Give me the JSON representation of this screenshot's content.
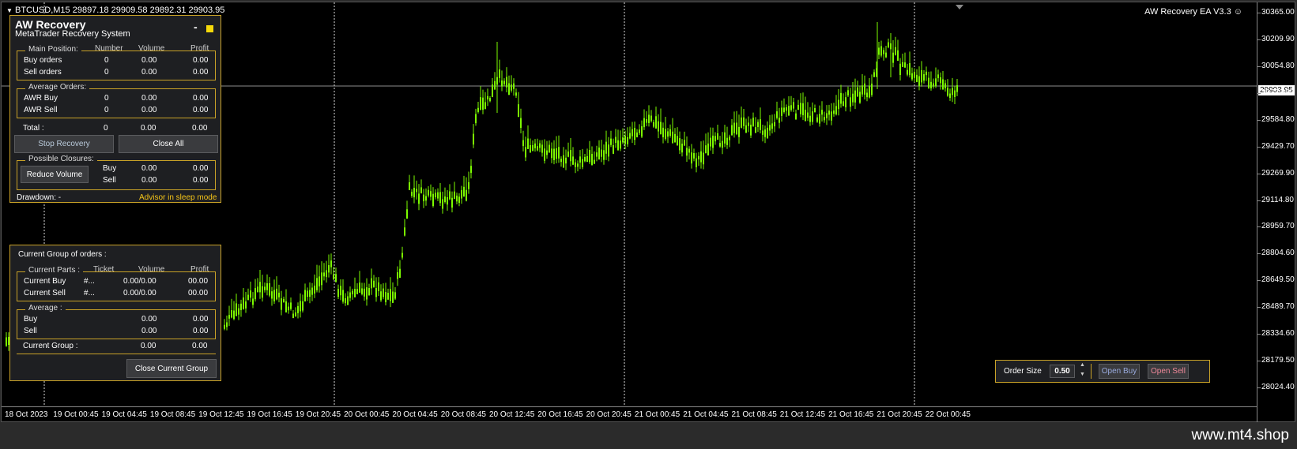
{
  "symbol_info": "BTCUSD,M15  29897.18 29909.58 29892.31 29903.95",
  "ea_label": "AW Recovery EA  V3.3",
  "price_labels": [
    "30365.00",
    "30209.90",
    "30054.80",
    "29739.90",
    "29584.80",
    "29429.70",
    "29269.90",
    "29114.80",
    "28959.70",
    "28804.60",
    "28649.50",
    "28489.70",
    "28334.60",
    "28179.50",
    "28024.40"
  ],
  "current_price": "29903.95",
  "time_labels": [
    "18 Oct 2023",
    "19 Oct 00:45",
    "19 Oct 04:45",
    "19 Oct 08:45",
    "19 Oct 12:45",
    "19 Oct 16:45",
    "19 Oct 20:45",
    "20 Oct 00:45",
    "20 Oct 04:45",
    "20 Oct 08:45",
    "20 Oct 12:45",
    "20 Oct 16:45",
    "20 Oct 20:45",
    "21 Oct 00:45",
    "21 Oct 04:45",
    "21 Oct 08:45",
    "21 Oct 12:45",
    "21 Oct 16:45",
    "21 Oct 20:45",
    "22 Oct 00:45"
  ],
  "colors": {
    "accent": "#c9a227",
    "candle": "#7CFC00",
    "status": "#f5c518"
  },
  "recovery_panel": {
    "title": "AW Recovery",
    "subtitle": "MetaTrader Recovery System",
    "minimize": "-",
    "main_position": {
      "legend": "Main Position:",
      "headers": [
        "Number",
        "Volume",
        "Profit"
      ],
      "rows": [
        {
          "label": "Buy orders",
          "number": "0",
          "volume": "0.00",
          "profit": "0.00"
        },
        {
          "label": "Sell orders",
          "number": "0",
          "volume": "0.00",
          "profit": "0.00"
        }
      ]
    },
    "average_orders": {
      "legend": "Average Orders:",
      "rows": [
        {
          "label": "AWR Buy",
          "number": "0",
          "volume": "0.00",
          "profit": "0.00"
        },
        {
          "label": "AWR Sell",
          "number": "0",
          "volume": "0.00",
          "profit": "0.00"
        }
      ]
    },
    "total": {
      "label": "Total :",
      "number": "0",
      "volume": "0.00",
      "profit": "0.00"
    },
    "stop_recovery": "Stop Recovery",
    "close_all": "Close All",
    "possible_closures": {
      "legend": "Possible Closures:",
      "reduce_volume": "Reduce Volume",
      "rows": [
        {
          "label": "Buy",
          "volume": "0.00",
          "profit": "0.00"
        },
        {
          "label": "Sell",
          "volume": "0.00",
          "profit": "0.00"
        }
      ]
    },
    "drawdown": "Drawdown: -",
    "status": "Advisor in sleep mode"
  },
  "group_panel": {
    "title": "Current Group of orders :",
    "current_parts": {
      "legend": "Current Parts :",
      "headers": [
        "Ticket",
        "Volume",
        "Profit"
      ],
      "rows": [
        {
          "label": "Current Buy",
          "ticket": "#...",
          "volume": "0.00/0.00",
          "profit": "00.00"
        },
        {
          "label": "Current Sell",
          "ticket": "#...",
          "volume": "0.00/0.00",
          "profit": "00.00"
        }
      ]
    },
    "average": {
      "legend": "Average :",
      "rows": [
        {
          "label": "Buy",
          "volume": "0.00",
          "profit": "0.00"
        },
        {
          "label": "Sell",
          "volume": "0.00",
          "profit": "0.00"
        }
      ]
    },
    "current_group": {
      "label": "Current Group :",
      "volume": "0.00",
      "profit": "0.00"
    },
    "close_group": "Close Current Group"
  },
  "order_panel": {
    "label": "Order Size",
    "value": "0.50",
    "open_buy": "Open Buy",
    "open_sell": "Open Sell"
  },
  "watermark": "www.mt4.shop"
}
